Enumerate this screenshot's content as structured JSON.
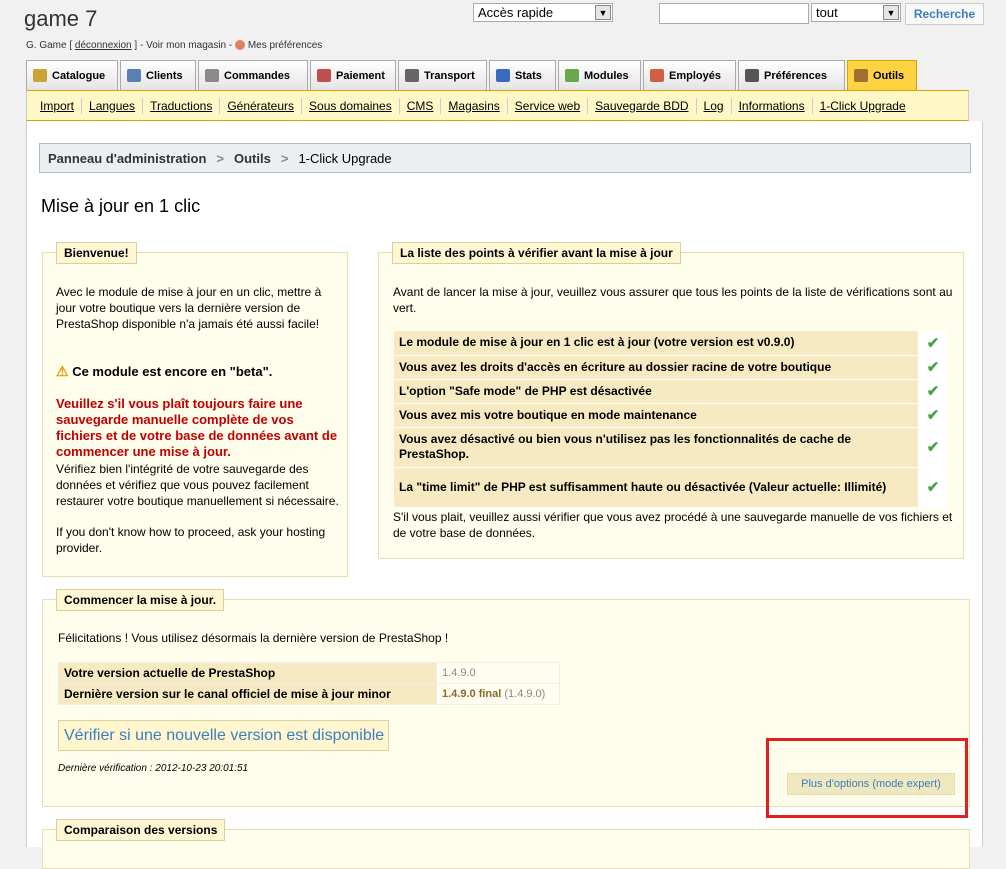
{
  "header": {
    "shop_name": "game 7",
    "user_prefix": "G. Game [",
    "logout": "déconnexion",
    "sep": "] -",
    "view_shop": "Voir mon magasin",
    "dash": "-",
    "preferences": "Mes préférences",
    "quick_access": "Accès rapide",
    "search_value": "",
    "search_type": "tout",
    "search_button": "Recherche"
  },
  "tabs": [
    {
      "label": "Catalogue",
      "color": "#c9a33a"
    },
    {
      "label": "Clients",
      "color": "#5a7fb0"
    },
    {
      "label": "Commandes",
      "color": "#8a8a8a"
    },
    {
      "label": "Paiement",
      "color": "#c05050"
    },
    {
      "label": "Transport",
      "color": "#666666"
    },
    {
      "label": "Stats",
      "color": "#3a6ac0"
    },
    {
      "label": "Modules",
      "color": "#6aa84f"
    },
    {
      "label": "Employés",
      "color": "#d06040"
    },
    {
      "label": "Préférences",
      "color": "#555555"
    },
    {
      "label": "Outils",
      "color": "#a07030"
    }
  ],
  "subnav": [
    "Import",
    "Langues",
    "Traductions",
    "Générateurs",
    "Sous domaines",
    "CMS",
    "Magasins",
    "Service web",
    "Sauvegarde BDD",
    "Log",
    "Informations",
    "1-Click Upgrade"
  ],
  "breadcrumb": {
    "root": "Panneau d'administration",
    "parent": "Outils",
    "current": "1-Click Upgrade",
    "sep": ">"
  },
  "page_title": "Mise à jour en 1 clic",
  "welcome": {
    "legend": "Bienvenue!",
    "intro": "Avec le module de mise à jour en un clic, mettre à jour votre boutique vers la dernière version de PrestaShop disponible n'a jamais été aussi facile!",
    "beta": "Ce module est encore en \"beta\".",
    "warning": "Veuillez s'il vous plaît toujours faire une sauvegarde manuelle complète de vos fichiers et de votre base de données avant de commencer une mise à jour.",
    "verify": "Vérifiez bien l'intégrité de votre sauvegarde des données et vérifiez que vous pouvez facilement restaurer votre boutique manuellement si nécessaire.",
    "help": "If you don't know how to proceed, ask your hosting provider."
  },
  "checklist": {
    "legend": "La liste des points à vérifier avant la mise à jour",
    "intro": "Avant de lancer la mise à jour, veuillez vous assurer que tous les points de la liste de vérifications sont au vert.",
    "items": [
      "Le module de mise à jour en 1 clic est à jour (votre version est v0.9.0)",
      "Vous avez les droits d'accès en écriture au dossier racine de votre boutique",
      "L'option \"Safe mode\" de PHP est désactivée",
      "Vous avez mis votre boutique en mode maintenance",
      "Vous avez désactivé ou bien vous n'utilisez pas les fonctionnalités de cache de PrestaShop.",
      "La \"time limit\" de PHP est suffisamment haute ou désactivée (Valeur actuelle: Illimité)"
    ],
    "footer": "S'il vous plait, veuillez aussi vérifier que vous avez procédé à une sauvegarde manuelle de vos fichiers et de votre base de données."
  },
  "upgrade": {
    "legend": "Commencer la mise à jour.",
    "congrats": "Félicitations ! Vous utilisez désormais la dernière version de PrestaShop !",
    "current_label": "Votre version actuelle de PrestaShop",
    "current_value": "1.4.9.0",
    "latest_label": "Dernière version sur le canal officiel de mise à jour minor",
    "latest_value": "1.4.9.0 final",
    "latest_paren": "(1.4.9.0)",
    "check_button": "Vérifier si une nouvelle version est disponible",
    "last_check": "Dernière vérification : 2012-10-23 20:01:51",
    "expert_button": "Plus d'options (mode expert)"
  },
  "compare": {
    "legend": "Comparaison des versions"
  }
}
